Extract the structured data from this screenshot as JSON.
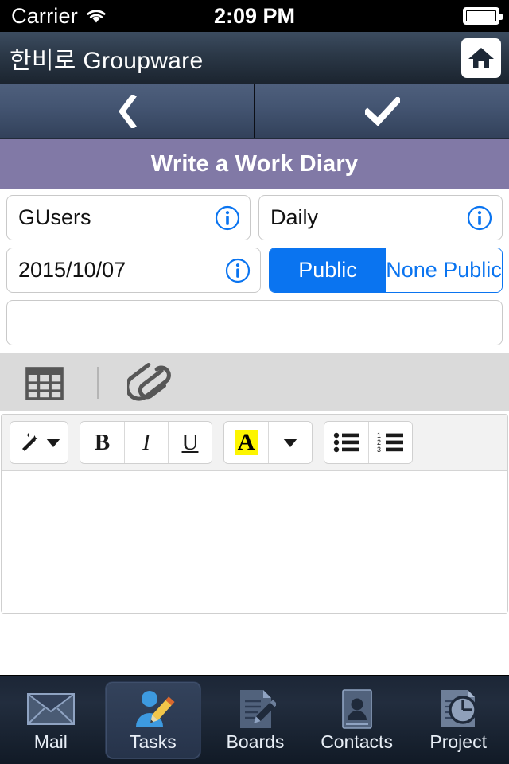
{
  "status_bar": {
    "carrier": "Carrier",
    "wifi_icon": "wifi-icon",
    "time": "2:09 PM",
    "battery_icon": "battery-full-icon"
  },
  "app_header": {
    "title": "한비로 Groupware",
    "home_icon": "home-icon"
  },
  "nav_bar": {
    "back_icon": "chevron-left-icon",
    "confirm_icon": "check-icon"
  },
  "page": {
    "title": "Write a Work Diary"
  },
  "form": {
    "group_field": {
      "value": "GUsers",
      "placeholder": "GUsers",
      "info_icon": "info-circle-icon"
    },
    "type_field": {
      "value": "Daily",
      "placeholder": "Daily",
      "info_icon": "info-circle-icon"
    },
    "date_field": {
      "value": "2015/10/07",
      "placeholder": "2015/10/07",
      "info_icon": "info-circle-icon"
    },
    "visibility": {
      "options": [
        "Public",
        "None Public"
      ],
      "selected": "Public",
      "active_color": "#0a74f0"
    },
    "subject_field": {
      "value": "",
      "placeholder": ""
    }
  },
  "attachment_bar": {
    "table_icon": "table-grid-icon",
    "attach_icon": "paperclip-icon"
  },
  "format_toolbar": {
    "styles_icon": "magic-wand-icon",
    "styles_caret": "chevron-down-icon",
    "bold_label": "B",
    "italic_label": "I",
    "underline_label": "U",
    "highlight_label": "A",
    "highlight_color": "#fdf500",
    "highlight_caret": "chevron-down-icon",
    "bullet_list_icon": "bullet-list-icon",
    "numbered_list_icon": "numbered-list-icon"
  },
  "editor": {
    "content": ""
  },
  "tab_bar": {
    "active": "Tasks",
    "items": [
      {
        "label": "Mail",
        "icon": "envelope-icon"
      },
      {
        "label": "Tasks",
        "icon": "person-pencil-icon"
      },
      {
        "label": "Boards",
        "icon": "document-pencil-icon"
      },
      {
        "label": "Contacts",
        "icon": "contact-card-icon"
      },
      {
        "label": "Project",
        "icon": "document-clock-icon"
      }
    ]
  }
}
